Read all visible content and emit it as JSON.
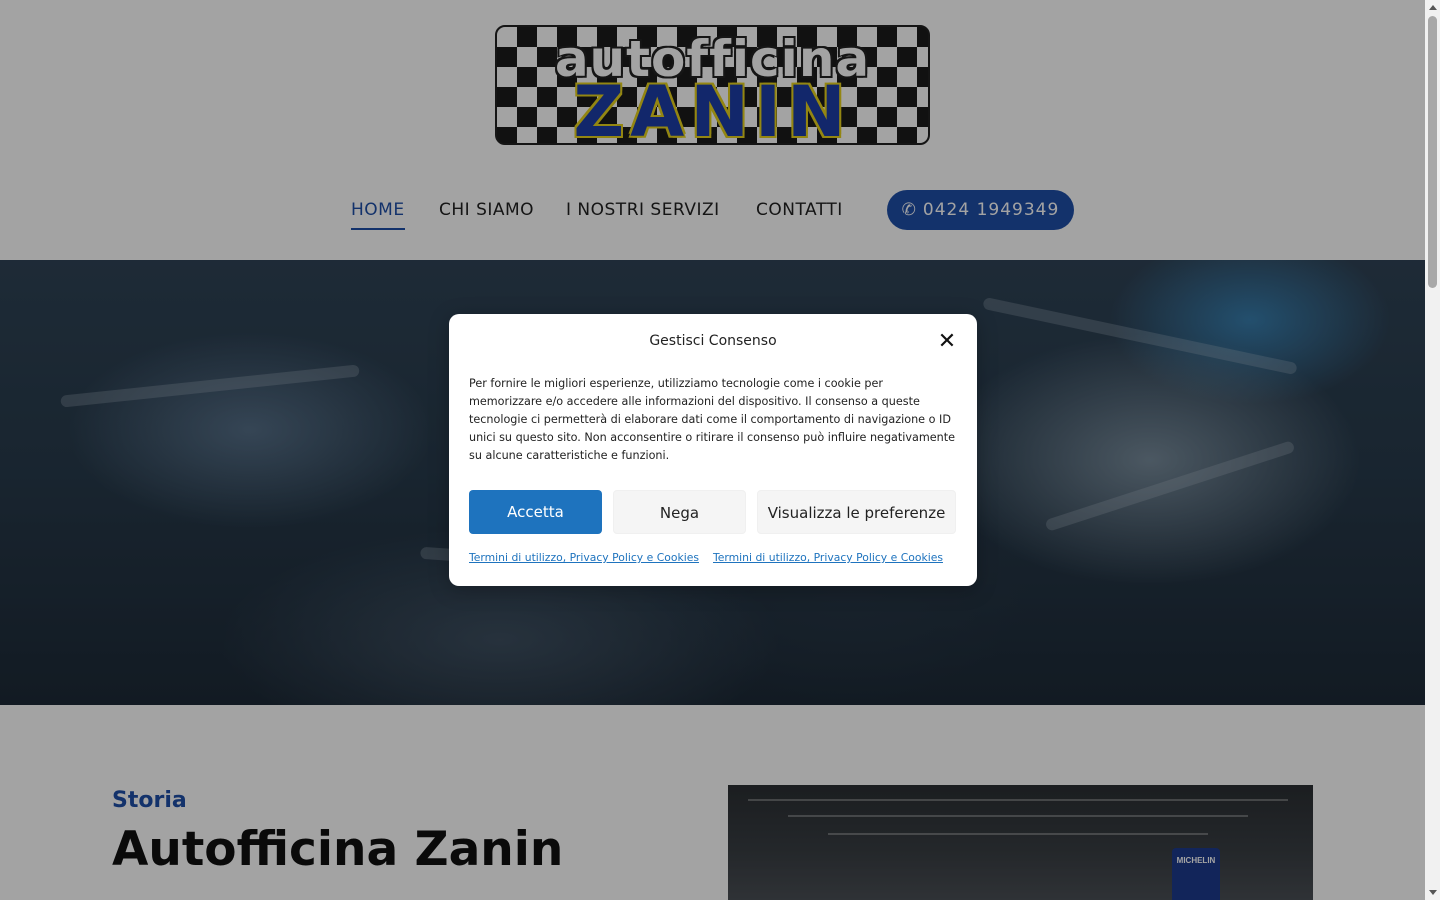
{
  "header": {
    "logo": {
      "line1": "autofficina",
      "line2": "ZANIN"
    },
    "nav": [
      {
        "label": "HOME",
        "active": true
      },
      {
        "label": "CHI SIAMO",
        "active": false
      },
      {
        "label": "I NOSTRI SERVIZI",
        "active": false
      },
      {
        "label": "CONTATTI",
        "active": false
      }
    ],
    "phone": {
      "icon": "phone-icon",
      "label": "0424 1949349"
    }
  },
  "section": {
    "kicker": "Storia",
    "title": "Autofficina Zanin",
    "image_sign": "MICHELIN"
  },
  "consent": {
    "title": "Gestisci Consenso",
    "close_icon": "close-icon",
    "text": "Per fornire le migliori esperienze, utilizziamo tecnologie come i cookie per memorizzare e/o accedere alle informazioni del dispositivo. Il consenso a queste tecnologie ci permetterà di elaborare dati come il comportamento di navigazione o ID unici su questo sito. Non acconsentire o ritirare il consenso può influire negativamente su alcune caratteristiche e funzioni.",
    "buttons": {
      "accept": "Accetta",
      "deny": "Nega",
      "preferences": "Visualizza le preferenze"
    },
    "links": [
      "Termini di utilizzo, Privacy Policy e Cookies",
      "Termini di utilizzo, Privacy Policy e Cookies"
    ]
  },
  "colors": {
    "brand_blue": "#1f4fa8",
    "accept_blue": "#1e73be",
    "overlay": "rgba(0,0,0,0.36)"
  }
}
